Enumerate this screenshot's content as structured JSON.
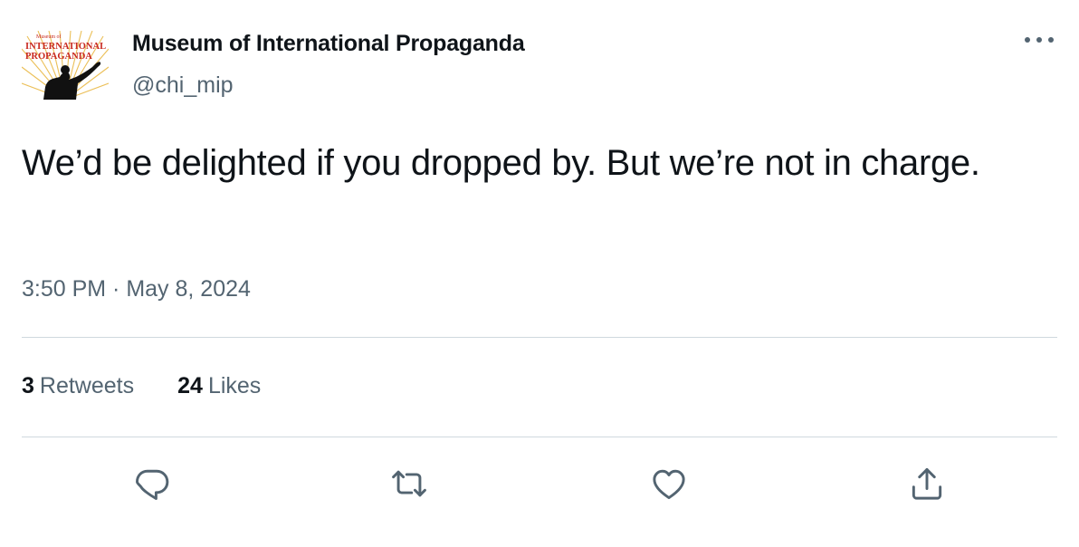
{
  "tweet": {
    "author": {
      "display_name": "Museum of International Propaganda",
      "handle": "@chi_mip",
      "avatar_text_line1": "Museum of",
      "avatar_text_line2": "INTERNATIONAL",
      "avatar_text_line3": "PROPAGANDA",
      "avatar_icon": "museum-logo"
    },
    "text": "We’d be delighted if you dropped by. But we’re not in charge.",
    "timestamp": "3:50 PM · May 8, 2024",
    "stats": {
      "retweets_count": "3",
      "retweets_label": "Retweets",
      "likes_count": "24",
      "likes_label": "Likes"
    },
    "actions": {
      "reply_icon": "reply-icon",
      "retweet_icon": "retweet-icon",
      "like_icon": "heart-icon",
      "share_icon": "share-icon",
      "more_icon": "more-icon"
    },
    "colors": {
      "text_primary": "#0f1419",
      "text_secondary": "#536471",
      "divider": "#cfd9de",
      "logo_red": "#c8281e",
      "logo_gold": "#e8b43a"
    }
  }
}
